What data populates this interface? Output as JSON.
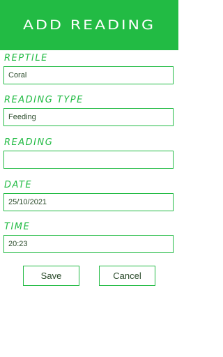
{
  "header": {
    "title": "Add Reading"
  },
  "form": {
    "reptile": {
      "label": "Reptile",
      "value": "Coral"
    },
    "reading_type": {
      "label": "Reading Type",
      "value": "Feeding"
    },
    "reading": {
      "label": "Reading",
      "value": ""
    },
    "date": {
      "label": "Date",
      "value": "25/10/2021"
    },
    "time": {
      "label": "Time",
      "value": "20:23"
    }
  },
  "actions": {
    "save_label": "Save",
    "cancel_label": "Cancel"
  },
  "colors": {
    "accent": "#22bb44",
    "text": "#2a4a2a",
    "background": "#ffffff"
  }
}
